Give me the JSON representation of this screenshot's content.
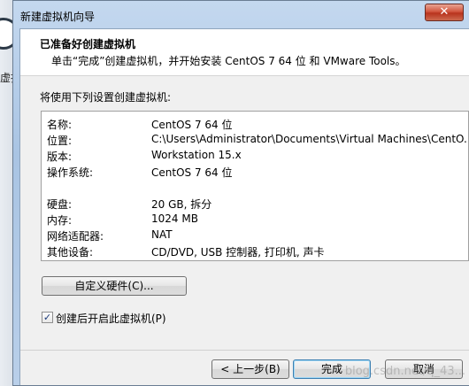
{
  "background": {
    "fragment": "虚拈"
  },
  "dialog": {
    "title": "新建虚拟机向导",
    "close_glyph": "✕",
    "header": {
      "title": "已准备好创建虚拟机",
      "subtitle": "单击“完成”创建虚拟机，并开始安装 CentOS 7 64 位 和 VMware Tools。"
    },
    "section_label": "将使用下列设置创建虚拟机:",
    "summary": [
      {
        "key": "名称:",
        "value": "CentOS 7 64 位"
      },
      {
        "key": "位置:",
        "value": "C:\\Users\\Administrator\\Documents\\Virtual Machines\\CentO..."
      },
      {
        "key": "版本:",
        "value": "Workstation 15.x"
      },
      {
        "key": "操作系统:",
        "value": "CentOS 7 64 位"
      },
      {
        "key": "硬盘:",
        "value": "20 GB, 拆分"
      },
      {
        "key": "内存:",
        "value": "1024 MB"
      },
      {
        "key": "网络适配器:",
        "value": "NAT"
      },
      {
        "key": "其他设备:",
        "value": "CD/DVD, USB 控制器, 打印机, 声卡"
      }
    ],
    "customize_button": "自定义硬件(C)...",
    "power_on_checkbox": {
      "label": "创建后开启此虚拟机(P)",
      "checked": true,
      "check_glyph": "✓"
    },
    "buttons": {
      "back": "< 上一步(B)",
      "finish": "完成",
      "cancel": "取消"
    },
    "watermark": "blog.csdn.net/q_43..."
  }
}
